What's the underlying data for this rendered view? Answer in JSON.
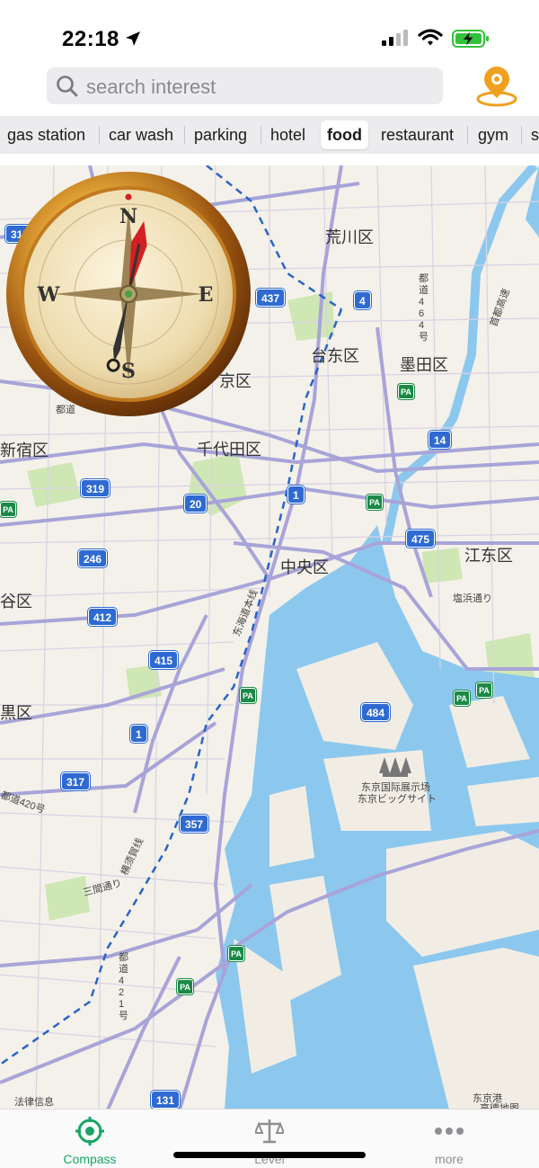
{
  "status_bar": {
    "time": "22:18"
  },
  "search": {
    "placeholder": "search interest"
  },
  "categories": [
    {
      "label": "gas station",
      "active": false
    },
    {
      "label": "car wash",
      "active": false
    },
    {
      "label": "parking",
      "active": false
    },
    {
      "label": "hotel",
      "active": false
    },
    {
      "label": "food",
      "active": true
    },
    {
      "label": "restaurant",
      "active": false
    },
    {
      "label": "gym",
      "active": false
    },
    {
      "label": "s",
      "active": false
    }
  ],
  "map": {
    "labels": {
      "arakawa": "荒川区",
      "taito": "台东区",
      "sumida": "墨田区",
      "bunkyo": "京区",
      "chiyoda": "千代田区",
      "shinjuku": "新宿区",
      "chuo": "中央区",
      "koto": "江东区",
      "shibuya": "谷区",
      "meguro": "黒区"
    },
    "small_labels": {
      "tokaido": "东海道本线",
      "yokosuka": "横须賀线",
      "shiohama": "塩浜通り",
      "sangen": "三間通り",
      "bigsight_1": "东京国际展示场",
      "bigsight_2": "东京ビッグサイト",
      "toto420": "都道420号",
      "toto421": "都道421号",
      "toto464": "都道464号",
      "shutoko": "首都高速",
      "hourei": "法律信息",
      "tokyo_port": "东京港",
      "map_credit": "高德地图",
      "toto_left": "都道"
    },
    "shields": {
      "s317a": "317",
      "s437": "437",
      "s4": "4",
      "s14": "14",
      "s319": "319",
      "s20": "20",
      "s1a": "1",
      "s475": "475",
      "s246": "246",
      "s412": "412",
      "s415": "415",
      "s484": "484",
      "s1b": "1",
      "s317b": "317",
      "s357": "357",
      "s131": "131"
    },
    "pa_label": "PA"
  },
  "compass": {
    "north": "N",
    "south": "S",
    "east": "E",
    "west": "W"
  },
  "tabs": [
    {
      "label": "Compass",
      "active": true,
      "icon": "compass-target-icon"
    },
    {
      "label": "Level",
      "active": false,
      "icon": "scale-icon"
    },
    {
      "label": "more",
      "active": false,
      "icon": "more-dots-icon"
    }
  ],
  "colors": {
    "accent_green": "#18a566",
    "location_orange": "#f0a020",
    "water": "#8cc8ee",
    "road_purple": "#a8a4d8"
  }
}
